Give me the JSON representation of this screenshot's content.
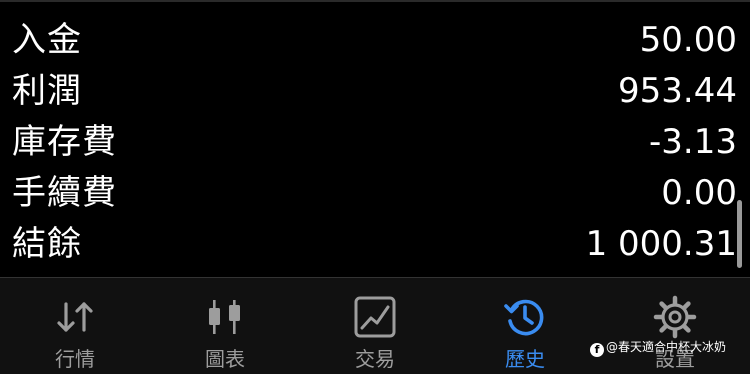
{
  "summary": {
    "rows": [
      {
        "label": "入金",
        "value": "50.00"
      },
      {
        "label": "利潤",
        "value": "953.44"
      },
      {
        "label": "庫存費",
        "value": "-3.13"
      },
      {
        "label": "手續費",
        "value": "0.00"
      },
      {
        "label": "結餘",
        "value": "1 000.31"
      }
    ]
  },
  "tabbar": {
    "tabs": [
      {
        "label": "行情",
        "icon": "quotes-arrows-icon"
      },
      {
        "label": "圖表",
        "icon": "candlestick-chart-icon"
      },
      {
        "label": "交易",
        "icon": "trade-line-chart-icon"
      },
      {
        "label": "歷史",
        "icon": "history-clock-icon",
        "active": true
      },
      {
        "label": "設置",
        "icon": "gear-icon"
      }
    ],
    "active_color": "#3a8cf0",
    "inactive_color": "#9d9d9d"
  },
  "watermark": {
    "text": "@春天適合中杯大冰奶"
  }
}
